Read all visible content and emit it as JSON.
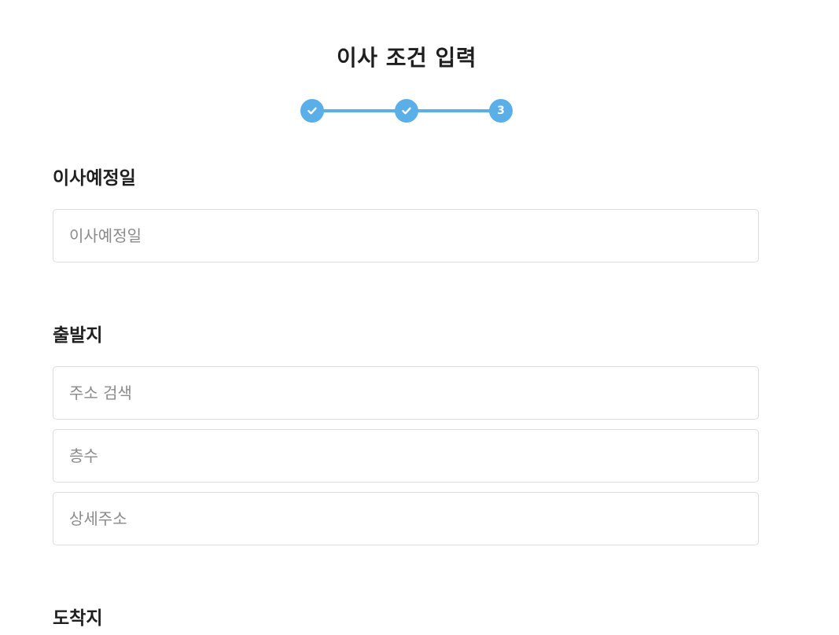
{
  "page": {
    "title": "이사 조건 입력"
  },
  "stepper": {
    "steps": [
      {
        "state": "done",
        "icon": "check-icon"
      },
      {
        "state": "done",
        "icon": "check-icon"
      },
      {
        "state": "current",
        "label": "3"
      }
    ],
    "accent_color": "#5aafe9"
  },
  "move_date": {
    "label": "이사예정일",
    "value": "",
    "placeholder": "이사예정일"
  },
  "departure": {
    "label": "출발지",
    "address_search": {
      "value": "",
      "placeholder": "주소 검색"
    },
    "floor": {
      "value": "",
      "placeholder": "층수"
    },
    "detail_address": {
      "value": "",
      "placeholder": "상세주소"
    }
  },
  "arrival": {
    "label": "도착지"
  }
}
